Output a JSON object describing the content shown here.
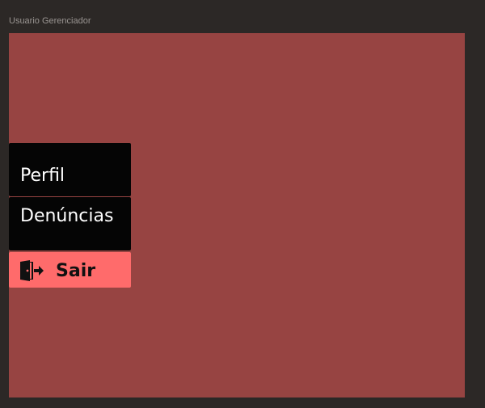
{
  "frame": {
    "title": "Usuario Gerenciador"
  },
  "menu": {
    "items": [
      {
        "label": "Perfil"
      },
      {
        "label": "Denúncias"
      }
    ],
    "logout": {
      "label": "Sair",
      "icon": "logout-door-icon"
    }
  },
  "colors": {
    "canvas_background": "#2c2826",
    "frame_background": "#974442",
    "menu_background": "#050505",
    "logout_background": "#ff6b6b"
  }
}
